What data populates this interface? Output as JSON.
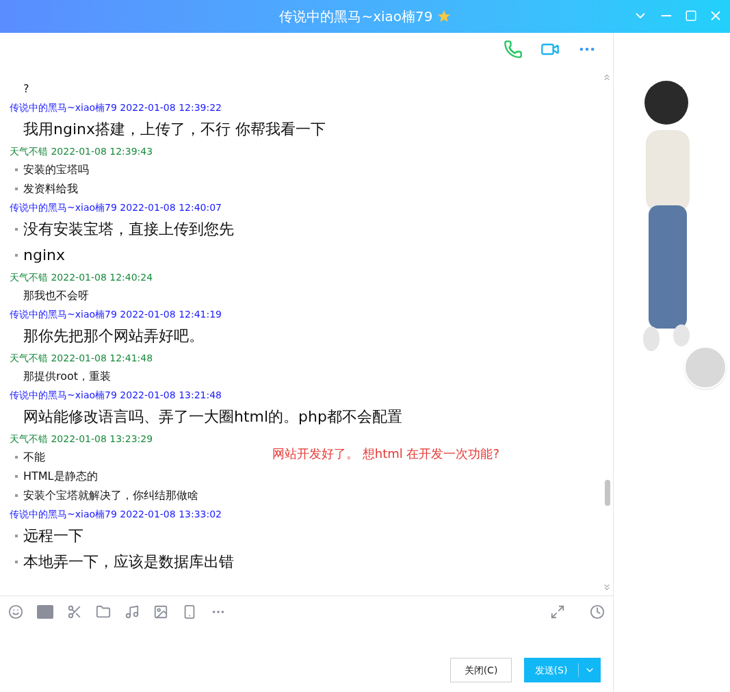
{
  "window": {
    "title": "传说中的黑马~xiao楠79"
  },
  "messages": [
    {
      "kind": "me",
      "lines": [
        "?"
      ]
    },
    {
      "kind": "them",
      "header": "传说中的黑马~xiao楠79 2022-01-08 12:39:22",
      "lines": [
        "我用nginx搭建，上传了，不行 你帮我看一下"
      ]
    },
    {
      "kind": "me",
      "header": "天气不错 2022-01-08 12:39:43",
      "lines": [
        "安装的宝塔吗",
        "发资料给我"
      ]
    },
    {
      "kind": "them",
      "header": "传说中的黑马~xiao楠79 2022-01-08 12:40:07",
      "lines": [
        "没有安装宝塔，直接上传到您先",
        "nginx"
      ]
    },
    {
      "kind": "me",
      "header": "天气不错 2022-01-08 12:40:24",
      "lines": [
        "那我也不会呀"
      ]
    },
    {
      "kind": "them",
      "header": "传说中的黑马~xiao楠79 2022-01-08 12:41:19",
      "lines": [
        "那你先把那个网站弄好吧。"
      ]
    },
    {
      "kind": "me",
      "header": "天气不错 2022-01-08 12:41:48",
      "lines": [
        "那提供root，重装"
      ]
    },
    {
      "kind": "them",
      "header": "传说中的黑马~xiao楠79 2022-01-08 13:21:48",
      "lines": [
        "网站能修改语言吗、弄了一大圈html的。php都不会配置"
      ]
    },
    {
      "kind": "me",
      "header": "天气不错 2022-01-08 13:23:29",
      "lines": [
        "不能",
        "HTML是静态的",
        "安装个宝塔就解决了，你纠结那做啥"
      ]
    },
    {
      "kind": "them",
      "header": "传说中的黑马~xiao楠79 2022-01-08 13:33:02",
      "lines": [
        "远程一下",
        "本地弄一下，应该是数据库出错"
      ]
    }
  ],
  "annotation": "网站开发好了。 想html 在开发一次功能?",
  "buttons": {
    "close": "关闭(C)",
    "send": "发送(S)"
  }
}
